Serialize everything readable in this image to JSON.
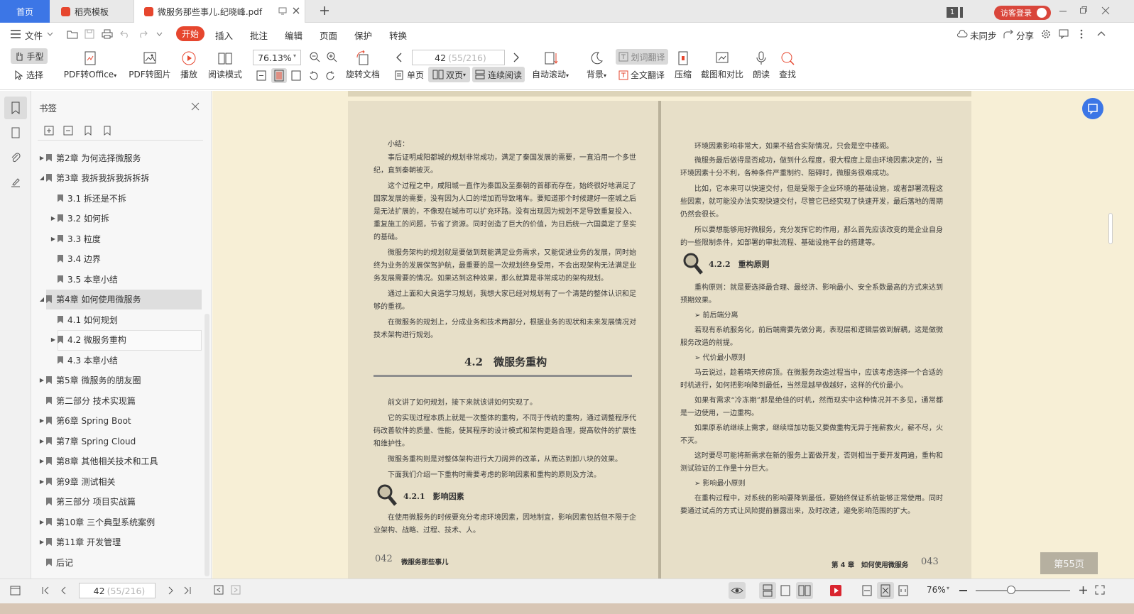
{
  "tabs": {
    "home": "首页",
    "template": "稻壳模板",
    "document": "微服务那些事儿.纪晓峰.pdf"
  },
  "window": {
    "page_badge": "1",
    "login": "访客登录"
  },
  "menu": {
    "file": "文件",
    "items": [
      "开始",
      "插入",
      "批注",
      "编辑",
      "页面",
      "保护",
      "转换"
    ],
    "sync": "未同步",
    "share": "分享"
  },
  "toolbar": {
    "hand": "手型",
    "select": "选择",
    "pdf_to_office": "PDF转Office",
    "pdf_to_image": "PDF转图片",
    "play": "播放",
    "read_mode": "阅读模式",
    "zoom": "76.13%",
    "rotate": "旋转文档",
    "page_current": "42",
    "page_total": "(55/216)",
    "single": "单页",
    "double": "双页",
    "continuous": "连续阅读",
    "auto_scroll": "自动滚动",
    "background": "背景",
    "word_translate": "划词翻译",
    "full_translate": "全文翻译",
    "compress": "压缩",
    "screenshot_compare": "截图和对比",
    "read_aloud": "朗读",
    "find": "查找"
  },
  "bookmarks": {
    "title": "书签",
    "items": [
      {
        "label": "第2章 为何选择微服务",
        "level": 0,
        "arrow": "▶"
      },
      {
        "label": "第3章 我拆我拆我拆拆拆",
        "level": 0,
        "arrow": "◢"
      },
      {
        "label": "3.1 拆还是不拆",
        "level": 1,
        "arrow": ""
      },
      {
        "label": "3.2 如何拆",
        "level": 1,
        "arrow": "▶"
      },
      {
        "label": "3.3 粒度",
        "level": 1,
        "arrow": "▶"
      },
      {
        "label": "3.4 边界",
        "level": 1,
        "arrow": ""
      },
      {
        "label": "3.5 本章小结",
        "level": 1,
        "arrow": ""
      },
      {
        "label": "第4章 如何使用微服务",
        "level": 0,
        "arrow": "◢"
      },
      {
        "label": "4.1 如何规划",
        "level": 1,
        "arrow": ""
      },
      {
        "label": "4.2 微服务重构",
        "level": 1,
        "arrow": "▶"
      },
      {
        "label": "4.3 本章小结",
        "level": 1,
        "arrow": ""
      },
      {
        "label": "第5章 微服务的朋友圈",
        "level": 0,
        "arrow": "▶"
      },
      {
        "label": "第二部分 技术实现篇",
        "level": 0,
        "arrow": ""
      },
      {
        "label": "第6章 Spring Boot",
        "level": 0,
        "arrow": "▶"
      },
      {
        "label": "第7章 Spring Cloud",
        "level": 0,
        "arrow": "▶"
      },
      {
        "label": "第8章 其他相关技术和工具",
        "level": 0,
        "arrow": "▶"
      },
      {
        "label": "第9章 测试相关",
        "level": 0,
        "arrow": "▶"
      },
      {
        "label": "第三部分 项目实战篇",
        "level": 0,
        "arrow": ""
      },
      {
        "label": "第10章 三个典型系统案例",
        "level": 0,
        "arrow": "▶"
      },
      {
        "label": "第11章 开发管理",
        "level": 0,
        "arrow": "▶"
      },
      {
        "label": "后记",
        "level": 0,
        "arrow": ""
      }
    ]
  },
  "left_page": {
    "p1": "小结：",
    "p2": "事后证明咸阳都城的规划非常成功，满足了秦国发展的需要，一直沿用一个多世纪，直到秦朝被灭。",
    "p3": "这个过程之中，咸阳城一直作为秦国及至秦朝的首都而存在，始终很好地满足了国家发展的需要，没有因为人口的增加而导致堵车。要知道那个时候建好一座城之后是无法扩展的，不像现在城市可以扩充环路。没有出现因为规划不足导致重复投入、重复施工的问题，节省了资源。同时创造了巨大的价值，为日后统一六国奠定了坚实的基础。",
    "p4": "微服务架构的规划就是要做到既能满足业务需求，又能促进业务的发展，同时始终为业务的发展保驾护航，最重要的是一次规划终身受用，不会出现架构无法满足业务发展需要的情况。如果达到这种效果，那么就算是非常成功的架构规划。",
    "p5": "通过上面和大良造学习规划，我想大家已经对规划有了一个清楚的整体认识和足够的重视。",
    "p6": "在微服务的规划上，分成业务和技术两部分，根据业务的现状和未来发展情况对技术架构进行规划。",
    "heading": "4.2　微服务重构",
    "p7": "前文讲了如何规划，接下来就该讲如何实现了。",
    "p8": "它的实现过程本质上就是一次整体的重构，不同于传统的重构，通过调整程序代码改善软件的质量、性能，使其程序的设计模式和架构更趋合理，提高软件的扩展性和维护性。",
    "p9": "微服务重构则是对整体架构进行大刀阔斧的改革，从而达到卸八块的效果。",
    "p10": "下面我们介绍一下重构时需要考虑的影响因素和重构的原则及方法。",
    "sub": "4.2.1　影响因素",
    "p11": "在使用微服务的时候要充分考虑环境因素，因地制宜，影响因素包括但不限于企业架构、战略、过程、技术、人。",
    "footer_num": "042",
    "footer_title": "微服务那些事儿"
  },
  "right_page": {
    "p1": "环境因素影响非常大，如果不结合实际情况，只会是空中楼阁。",
    "p2": "微服务最后做得是否成功，做到什么程度，很大程度上是由环境因素决定的，当环境因素十分不利，各种条件严重制约、阻碍时，微服务很难成功。",
    "p3": "比如，它本来可以快速交付，但是受限于企业环境的基础设施，或者部署流程这些因素，就可能没办法实现快速交付，尽管它已经实现了快速开发，最后落地的周期仍然会很长。",
    "p4": "所以要想能够用好微服务，充分发挥它的作用，那么首先应该改变的是企业自身的一些限制条件，如部署的审批流程、基础设施平台的搭建等。",
    "sub": "4.2.2　重构原则",
    "p5": "重构原则：就是要选择最合理、最经济、影响最小、安全系数最高的方式来达到预期效果。",
    "b1": "➢ 前后端分离",
    "p6": "若现有系统服务化，前后端需要先做分离，表现层和逻辑层做到解耦，这是做微服务改造的前提。",
    "b2": "➢ 代价最小原则",
    "p7": "马云说过，趁着晴天修房顶。在微服务改造过程当中，应该考虑选择一个合适的时机进行，如何把影响降到最低，当然是越早做越好，这样的代价最小。",
    "p8": "如果有需求“冷冻期”那是绝佳的时机，然而现实中这种情况并不多见，通常都是一边使用，一边重构。",
    "p9": "如果原系统继续上需求，继续增加功能又要做重构无异于拖薪救火，薪不尽，火不灭。",
    "p10": "这时要尽可能将新需求在新的服务上面做开发，否则相当于要开发两遍，重构和测试验证的工作量十分巨大。",
    "b3": "➢ 影响最小原则",
    "p11": "在重构过程中，对系统的影响要降到最低，要始终保证系统能够正常使用。同时要通过试点的方式让风险提前暴露出来，及时改进，避免影响范围的扩大。",
    "footer_title": "第 4 章　如何使用微服务",
    "footer_num": "043"
  },
  "page_badge": "第55页",
  "status": {
    "page_current": "42",
    "page_total": "(55/216)",
    "zoom": "76%"
  },
  "colors": {
    "accent": "#e6462e",
    "tab_active": "#3c76e6",
    "page_bg": "#e7dfc8",
    "desk_bg": "#f7efd6"
  }
}
